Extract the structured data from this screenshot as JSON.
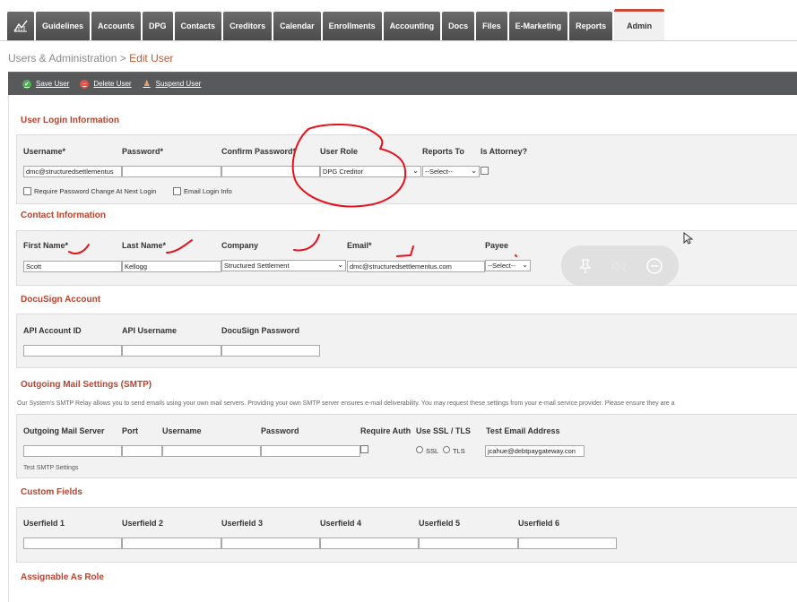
{
  "nav": {
    "home_icon": "home-chart-icon",
    "tabs": [
      "Guidelines",
      "Accounts",
      "DPG",
      "Contacts",
      "Creditors",
      "Calendar",
      "Enrollments",
      "Accounting",
      "Docs",
      "Files",
      "E-Marketing",
      "Reports",
      "Admin"
    ],
    "active": "Admin"
  },
  "breadcrumb": {
    "parent": "Users & Administration",
    "sep": " > ",
    "current": "Edit User"
  },
  "toolbar": {
    "save": "Save User",
    "delete": "Delete User",
    "suspend": "Suspend User"
  },
  "login": {
    "title": "User Login Information",
    "username_label": "Username*",
    "password_label": "Password*",
    "confirm_label": "Confirm Password*",
    "role_label": "User Role",
    "reports_label": "Reports To",
    "attorney_label": "Is Attorney?",
    "username_value": "dmc@structuredsettlementus",
    "role_value": "DPG Creditor",
    "reports_value": "--Select--",
    "require_change": "Require Password Change At Next Login",
    "email_login": "Email Login Info"
  },
  "contact": {
    "title": "Contact Information",
    "first_label": "First Name*",
    "last_label": "Last Name*",
    "company_label": "Company",
    "email_label": "Email*",
    "payee_label": "Payee",
    "first_value": "Scott",
    "last_value": "Kellogg",
    "company_value": "Structured Settlement",
    "email_value": "dmc@structuredsettlementus.com",
    "payee_value": "--Select--"
  },
  "docusign": {
    "title": "DocuSign Account",
    "api_id_label": "API Account ID",
    "api_user_label": "API Username",
    "pw_label": "DocuSign Password"
  },
  "smtp": {
    "title": "Outgoing Mail Settings (SMTP)",
    "note": "Our System's SMTP Relay allows you to send emails using your own mail servers. Providing your own SMTP server ensures e-mail deliverability. You may request these settings from your e-mail service provider. Please ensure they are a",
    "server_label": "Outgoing Mail Server",
    "port_label": "Port",
    "user_label": "Username",
    "pw_label": "Password",
    "auth_label": "Require Auth",
    "ssl_label": "Use SSL / TLS",
    "test_label": "Test Email Address",
    "ssl_opt": "SSL",
    "tls_opt": "TLS",
    "test_value": "jcahue@debtpaygateway.con",
    "test_link": "Test SMTP Settings"
  },
  "custom": {
    "title": "Custom Fields",
    "labels": [
      "Userfield 1",
      "Userfield 2",
      "Userfield 3",
      "Userfield 4",
      "Userfield 5",
      "Userfield 6"
    ]
  },
  "assignable": {
    "title": "Assignable As Role"
  },
  "colors": {
    "accent": "#b8432e",
    "tab_bg": "#5a5a5a",
    "toolbar_bg": "#58595b",
    "annotation": "#e8101a"
  },
  "overlay_icons": [
    "pin-icon",
    "mute-icon",
    "minus-circle-icon"
  ]
}
